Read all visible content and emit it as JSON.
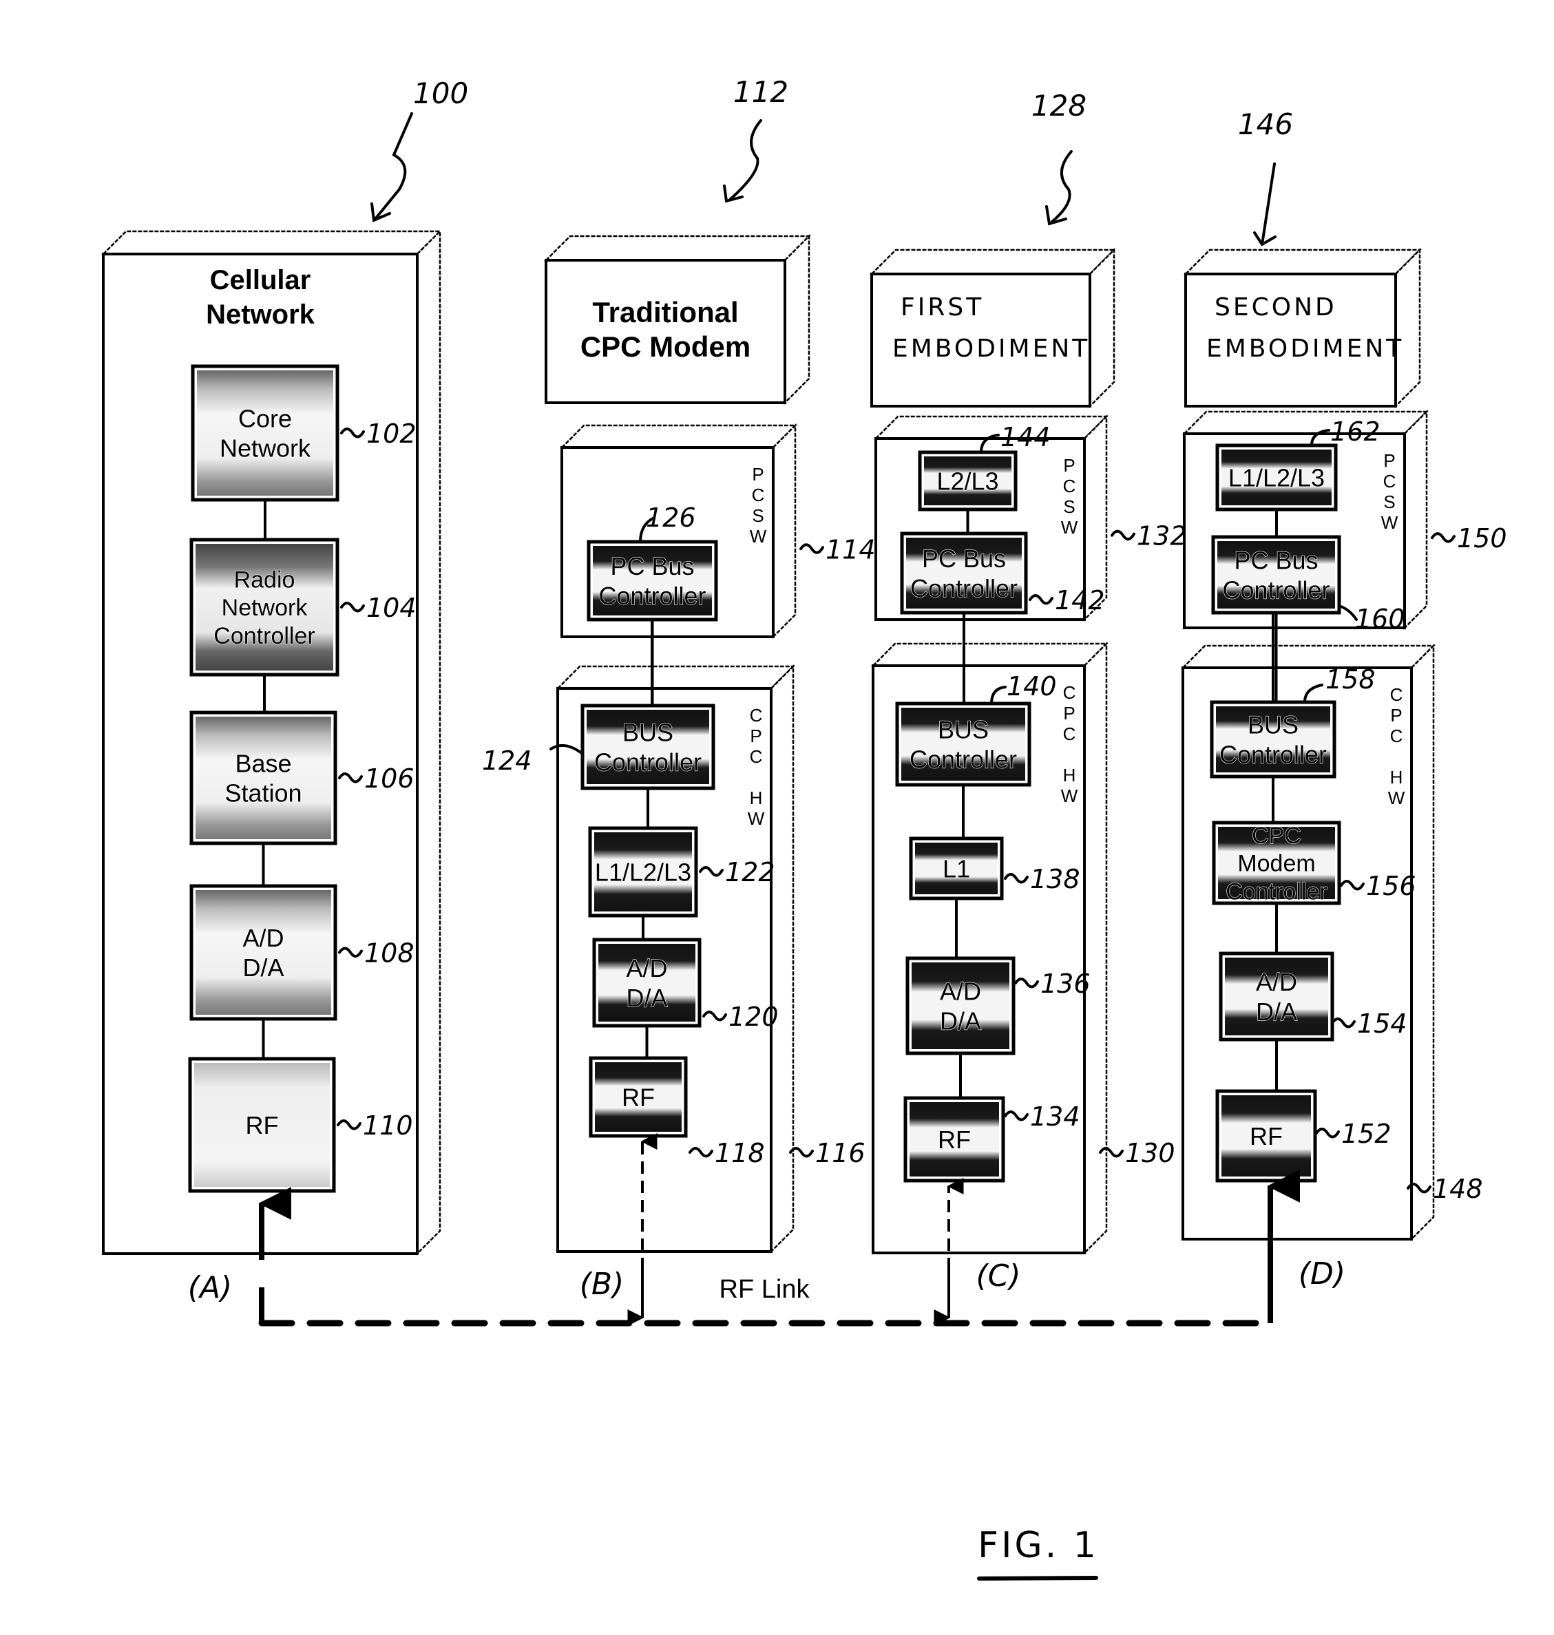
{
  "figure": {
    "caption": "FIG. 1",
    "link_label": "RF Link"
  },
  "columns": [
    {
      "id": "A",
      "ref": "100",
      "title_lines": [
        "Cellular",
        "Network"
      ],
      "title_style": "typed",
      "branch_label": "(A)",
      "container_ref": "",
      "blocks": [
        {
          "lines": [
            "Core",
            "Network"
          ],
          "ref": "102",
          "shade": "light"
        },
        {
          "lines": [
            "Radio",
            "Network",
            "Controller"
          ],
          "ref": "104",
          "shade": "mid"
        },
        {
          "lines": [
            "Base",
            "Station"
          ],
          "ref": "106",
          "shade": "light"
        },
        {
          "lines": [
            "A/D",
            "D/A"
          ],
          "ref": "108",
          "shade": "light"
        },
        {
          "lines": [
            "RF"
          ],
          "ref": "110",
          "shade": "pale"
        }
      ]
    },
    {
      "id": "B",
      "ref": "112",
      "title_lines": [
        "Traditional",
        "CPC Modem"
      ],
      "title_style": "typed",
      "branch_label": "(B)",
      "pc_sw": {
        "side_label": [
          "P",
          "C",
          "S",
          "W"
        ],
        "ref": "114",
        "blocks": [
          {
            "lines": [
              "PC Bus",
              "Controller"
            ],
            "ref": "126",
            "shade": "dark"
          }
        ]
      },
      "cpc_hw": {
        "side_label": [
          "C",
          "P",
          "C",
          "",
          "H",
          "W"
        ],
        "ref": "116",
        "blocks": [
          {
            "lines": [
              "BUS",
              "Controller"
            ],
            "ref": "124",
            "shade": "dark"
          },
          {
            "lines": [
              "L1/L2/L3"
            ],
            "ref": "122",
            "shade": "dark"
          },
          {
            "lines": [
              "A/D",
              "D/A"
            ],
            "ref": "120",
            "shade": "dark"
          },
          {
            "lines": [
              "RF"
            ],
            "ref": "118",
            "shade": "dark"
          }
        ]
      }
    },
    {
      "id": "C",
      "ref": "128",
      "title_lines": [
        "FIRST",
        "EMBODIMENT"
      ],
      "title_style": "handwritten",
      "branch_label": "(C)",
      "pc_sw": {
        "side_label": [
          "P",
          "C",
          "S",
          "W"
        ],
        "ref": "132",
        "blocks": [
          {
            "lines": [
              "L2/L3"
            ],
            "ref": "144",
            "shade": "dark"
          },
          {
            "lines": [
              "PC Bus",
              "Controller"
            ],
            "ref": "142",
            "shade": "dark"
          }
        ]
      },
      "cpc_hw": {
        "side_label": [
          "C",
          "P",
          "C",
          "",
          "H",
          "W"
        ],
        "ref": "130",
        "blocks": [
          {
            "lines": [
              "BUS",
              "Controller"
            ],
            "ref": "140",
            "shade": "dark"
          },
          {
            "lines": [
              "L1"
            ],
            "ref": "138",
            "shade": "dark"
          },
          {
            "lines": [
              "A/D",
              "D/A"
            ],
            "ref": "136",
            "shade": "dark"
          },
          {
            "lines": [
              "RF"
            ],
            "ref": "134",
            "shade": "dark"
          }
        ]
      }
    },
    {
      "id": "D",
      "ref": "146",
      "title_lines": [
        "SECOND",
        "EMBODIMENT"
      ],
      "title_style": "handwritten",
      "branch_label": "(D)",
      "pc_sw": {
        "side_label": [
          "P",
          "C",
          "S",
          "W"
        ],
        "ref": "150",
        "blocks": [
          {
            "lines": [
              "L1/L2/L3"
            ],
            "ref": "162",
            "shade": "dark"
          },
          {
            "lines": [
              "PC Bus",
              "Controller"
            ],
            "ref": "160",
            "shade": "dark"
          }
        ]
      },
      "cpc_hw": {
        "side_label": [
          "C",
          "P",
          "C",
          "",
          "H",
          "W"
        ],
        "ref": "148",
        "blocks": [
          {
            "lines": [
              "BUS",
              "Controller"
            ],
            "ref": "158",
            "shade": "dark"
          },
          {
            "lines": [
              "CPC",
              "Modem",
              "Controller"
            ],
            "ref": "156",
            "shade": "dark"
          },
          {
            "lines": [
              "A/D",
              "D/A"
            ],
            "ref": "154",
            "shade": "dark"
          },
          {
            "lines": [
              "RF"
            ],
            "ref": "152",
            "shade": "dark"
          }
        ]
      }
    }
  ]
}
